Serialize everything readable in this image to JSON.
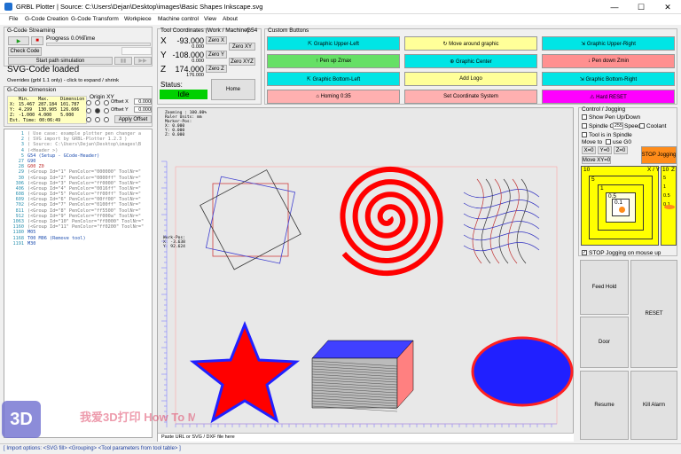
{
  "window": {
    "title": "GRBL Plotter | Source: C:\\Users\\Dejan\\Desktop\\images\\Basic Shapes Inkscape.svg",
    "min": "—",
    "max": "☐",
    "close": "✕"
  },
  "menu": [
    "File",
    "G-Code Creation",
    "G-Code Transform",
    "Workpiece",
    "Machine control",
    "View",
    "About"
  ],
  "streaming": {
    "group": "G-Code Streaming",
    "progress": "Progress 0.0%",
    "time": "Time",
    "check_code": "Check Code",
    "simulation": "Start path simulation"
  },
  "svg_loaded": "SVG-Code loaded",
  "overrides": "Overrides (grbl 1.1 only) - click to expand / shrink",
  "dimension": {
    "group": "G-Code Dimension",
    "origin": "Origin XY",
    "offset_x_label": "Offset X",
    "offset_x": "0.000",
    "offset_y_label": "Offset Y",
    "offset_y": "0.000",
    "apply": "Apply Offset",
    "table": [
      [
        "",
        "Min.",
        "Max.",
        "Dimension"
      ],
      [
        "X:",
        "15.467",
        "287.184",
        "101.787"
      ],
      [
        "Y:",
        "4.299",
        "130.905",
        "126.606"
      ],
      [
        "Z:",
        "-1.000",
        "4.000",
        "5.000"
      ]
    ],
    "time": "Est. Time: 00:06:49"
  },
  "code": {
    "line_numbers": [
      "1",
      "2",
      "3",
      "4",
      "5",
      "27",
      "28",
      "29",
      "30",
      "306",
      "406",
      "608",
      "609",
      "702",
      "811",
      "912",
      "1063",
      "1160",
      "1180",
      "1168",
      "1191"
    ],
    "lines": [
      "( Use case: example plotter pen changer a",
      "( SVG import by GRBL-Plotter 1.2.3 )",
      "( Source: C:\\Users\\Dejan\\Desktop\\images\\B",
      "(<Header >)",
      "G54 (Setup - GCode-Header)",
      "G90",
      "G00 Z0",
      "(<Group Id=\"1\" PenColor=\"000000\" ToolNr=\"",
      "(<Group Id=\"2\" PenColor=\"0000ff\" ToolNr=\"",
      "(<Group Id=\"3\" PenColor=\"ff0000\" ToolNr=\"",
      "(<Group Id=\"4\" PenColor=\"0016ff\" ToolNr=\"",
      "(<Group Id=\"5\" PenColor=\"ff00ff\" ToolNr=\"",
      "(<Group Id=\"6\" PenColor=\"00ff00\" ToolNr=\"",
      "(<Group Id=\"7\" PenColor=\"0100ff\" ToolNr=\"",
      "(<Group Id=\"8\" PenColor=\"ff5500\" ToolNr=\"",
      "(<Group Id=\"9\" PenColor=\"ff000a\" ToolNr=\"",
      "(<Group Id=\"10\" PenColor=\"ff0000\" ToolNr=\"",
      "(<Group Id=\"11\" PenColor=\"ff0200\" ToolNr=\"",
      "M05",
      "T00 M06 (Remove tool)",
      "M30"
    ]
  },
  "coords": {
    "group": "Tool Coordinates (Work / Machine)",
    "wcs": "G54",
    "x_label": "X",
    "x_work": "-93.000",
    "x_machine": "0.000",
    "y_label": "Y",
    "y_work": "-108.000",
    "y_machine": "0.000",
    "z_label": "Z",
    "z_work": "174.000",
    "z_machine": "176.000",
    "zero_x": "Zero X",
    "zero_y": "Zero Y",
    "zero_z": "Zero Z",
    "zero_xy": "Zero XY",
    "zero_xyz": "Zero XYZ",
    "status_label": "Status:",
    "status": "Idle",
    "home": "Home"
  },
  "custom": {
    "group": "Custom Buttons",
    "buttons": [
      {
        "label": "⇱ Graphic Upper-Left",
        "color": "#00e5e5"
      },
      {
        "label": "↻ Move around graphic",
        "color": "#ffff99"
      },
      {
        "label": "⇲ Graphic Upper-Right",
        "color": "#00e5e5"
      },
      {
        "label": "↑ Pen up Zmax",
        "color": "#66e066"
      },
      {
        "label": "⊕ Graphic Center",
        "color": "#00e5e5"
      },
      {
        "label": "↓ Pen down Zmin",
        "color": "#ff9090"
      },
      {
        "label": "⇱ Graphic Bottom-Left",
        "color": "#00e5e5"
      },
      {
        "label": "Add Logo",
        "color": "#ffff99"
      },
      {
        "label": "⇲ Graphic Bottom-Right",
        "color": "#00e5e5"
      },
      {
        "label": "⌂ Homing 0:35",
        "color": "#ffb0b0"
      },
      {
        "label": "Set Coordinate System",
        "color": "#ffb0b0"
      },
      {
        "label": "⚠ Hard RESET",
        "color": "#ff00ff"
      }
    ]
  },
  "canvas": {
    "header": [
      "Zooming    : 100.00%",
      "Ruler Units: mm",
      "Marker-Pos:",
      "X:  0.000",
      "Y:  0.000",
      "Z:  0.000"
    ],
    "workpos": [
      "Work-Pos:",
      "X: -3.638",
      "Y: 92.624"
    ],
    "file_input": "Paste URL or SVG / DXF file here"
  },
  "jog": {
    "group": "Control / Jogging",
    "show_pen": "Show Pen Up/Down",
    "spindle_cw": "Spindle CW",
    "speed_val": "255",
    "speed": "Speed",
    "coolant": "Coolant",
    "tool_in_spindle": "Tool is in Spindle",
    "move_to": "Move to",
    "use_g0": "use G0",
    "x0": "X=0",
    "y0": "Y=0",
    "z0": "Z=0",
    "xy0": "Move XY=0",
    "stop": "STOP Jogging",
    "stop_on_mouse": "STOP Jogging on mouse up",
    "xy_label": "X / Y",
    "z_label": "Z",
    "step_xy": [
      "10",
      "5",
      "1",
      "0.5",
      "0.1"
    ],
    "step_z": [
      "10",
      "5",
      "1",
      "0.5",
      "0.1"
    ]
  },
  "control": {
    "feed_hold": "Feed Hold",
    "reset": "RESET",
    "door": "Door",
    "resume": "Resume",
    "kill_alarm": "Kill Alarm"
  },
  "statusbar": "[ Import options: <SVG fill> <Grouping> <Tool parameters from tool table> ]",
  "watermark": "我爱3D打印 How To MECHATRONICS 52SB 3dprinting.com"
}
